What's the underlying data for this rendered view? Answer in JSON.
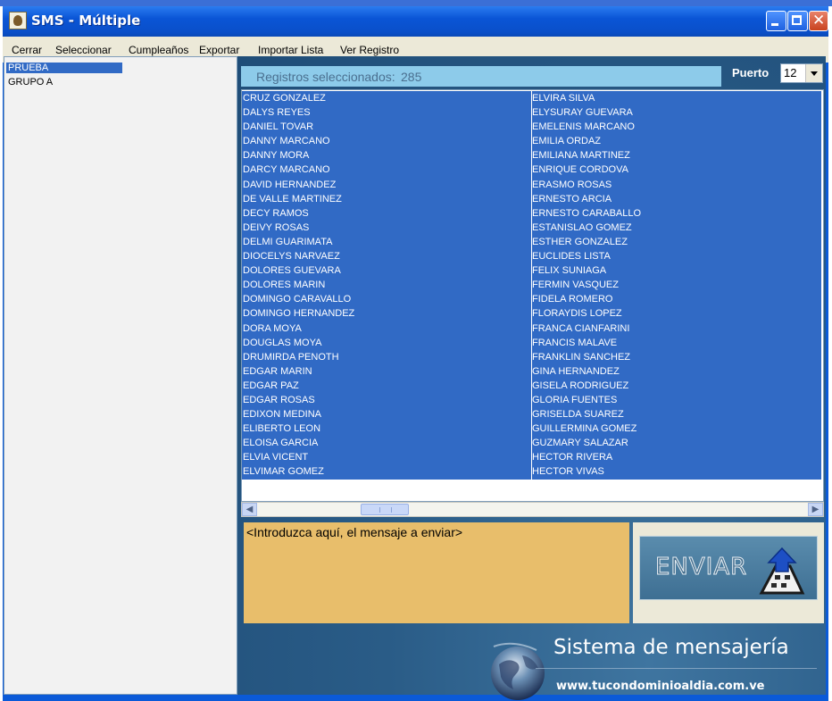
{
  "window": {
    "title": "SMS - Múltiple"
  },
  "menu": {
    "items": [
      "Cerrar",
      "Seleccionar",
      "Cumpleaños",
      "Exportar",
      "Importar Lista",
      "Ver Registro"
    ]
  },
  "groups": {
    "items": [
      "PRUEBA",
      "GRUPO A"
    ],
    "selected": "PRUEBA"
  },
  "records": {
    "label": "Registros seleccionados:",
    "count": "285"
  },
  "puerto": {
    "label": "Puerto",
    "value": "12"
  },
  "contacts": {
    "column1": [
      "CRUZ GONZALEZ",
      "DALYS  REYES",
      "DANIEL TOVAR",
      "DANNY MARCANO",
      "DANNY MORA",
      "DARCY MARCANO",
      "DAVID HERNANDEZ",
      "DE VALLE MARTINEZ",
      "DECY RAMOS",
      "DEIVY ROSAS",
      "DELMI GUARIMATA",
      "DIOCELYS NARVAEZ",
      "DOLORES GUEVARA",
      "DOLORES MARIN",
      "DOMINGO CARAVALLO",
      "DOMINGO HERNANDEZ",
      "DORA MOYA",
      "DOUGLAS MOYA",
      "DRUMIRDA PENOTH",
      "EDGAR MARIN",
      "EDGAR PAZ",
      "EDGAR ROSAS",
      "EDIXON MEDINA",
      "ELIBERTO LEON",
      "ELOISA GARCIA",
      "ELVIA VICENT",
      "ELVIMAR GOMEZ"
    ],
    "column2": [
      "ELVIRA SILVA",
      "ELYSURAY GUEVARA",
      "EMELENIS MARCANO",
      "EMILIA ORDAZ",
      "EMILIANA MARTINEZ",
      "ENRIQUE CORDOVA",
      "ERASMO ROSAS",
      "ERNESTO ARCIA",
      "ERNESTO CARABALLO",
      "ESTANISLAO GOMEZ",
      "ESTHER GONZALEZ",
      "EUCLIDES LISTA",
      "FELIX SUNIAGA",
      "FERMIN VASQUEZ",
      "FIDELA ROMERO",
      "FLORAYDIS LOPEZ",
      "FRANCA CIANFARINI",
      "FRANCIS MALAVE",
      "FRANKLIN SANCHEZ",
      "GINA HERNANDEZ",
      "GISELA RODRIGUEZ",
      "GLORIA FUENTES",
      "GRISELDA SUAREZ",
      "GUILLERMINA GOMEZ",
      "GUZMARY SALAZAR",
      "HECTOR RIVERA",
      "HECTOR VIVAS"
    ]
  },
  "message": {
    "placeholder": "<Introduzca aquí, el mensaje a enviar>"
  },
  "send": {
    "label": "ENVIAR"
  },
  "footer": {
    "title": "Sistema de mensajería",
    "url": "www.tucondominioaldia.com.ve"
  },
  "colors": {
    "titlebar": "#0a55d6",
    "selection": "#316ac5",
    "countbar": "#8dcbea",
    "message_bg": "#e8be6b",
    "main_bg": "#2a5c87"
  },
  "icons": {
    "app": "sms-app-icon",
    "send": "send-arrow-icon",
    "globe": "globe-icon"
  }
}
